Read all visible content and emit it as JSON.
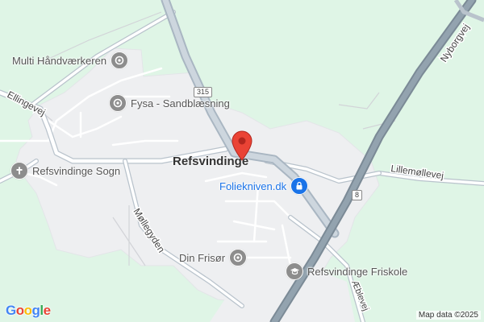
{
  "town": {
    "name": "Refsvindinge"
  },
  "pois": [
    {
      "id": "multi",
      "label": "Multi Håndværkeren",
      "icon": "map-pin-icon",
      "color": "#8d8d8d"
    },
    {
      "id": "fysa",
      "label": "Fysa - Sandblæsning",
      "icon": "map-pin-icon",
      "color": "#8d8d8d"
    },
    {
      "id": "sogn",
      "label": "Refsvindinge Sogn",
      "icon": "church-cross-icon",
      "color": "#8d8d8d"
    },
    {
      "id": "folie",
      "label": "Foliekniven.dk",
      "icon": "shopping-bag-icon",
      "color": "#1a73e8"
    },
    {
      "id": "frisor",
      "label": "Din Frisør",
      "icon": "map-pin-icon",
      "color": "#8d8d8d"
    },
    {
      "id": "friskole",
      "label": "Refsvindinge Friskole",
      "icon": "school-cap-icon",
      "color": "#8d8d8d"
    }
  ],
  "roads": {
    "ellingevej": "Ellingevej",
    "mollegyden": "Møllegyden",
    "lillemollevej": "Lillemøllevej",
    "nyborgvej": "Nyborgvej",
    "aeblevej": "Æblevej"
  },
  "route_shields": {
    "r315": "315",
    "r8": "8"
  },
  "marker": {
    "icon": "red-map-marker-icon",
    "color": "#ea4335"
  },
  "attribution": "Map data ©2025",
  "logo": "Google"
}
